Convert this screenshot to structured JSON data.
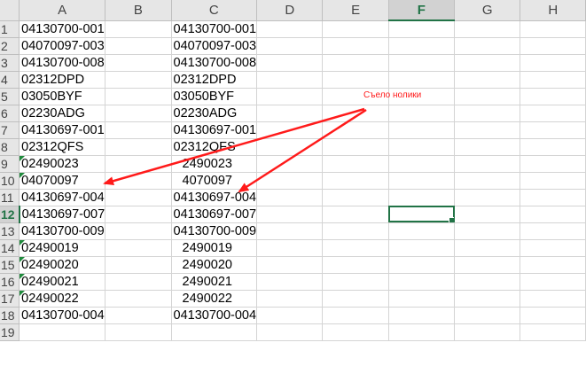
{
  "columns": [
    "A",
    "B",
    "C",
    "D",
    "E",
    "F",
    "G",
    "H"
  ],
  "row_numbers": [
    "1",
    "2",
    "3",
    "4",
    "5",
    "6",
    "7",
    "8",
    "9",
    "10",
    "11",
    "12",
    "13",
    "14",
    "15",
    "16",
    "17",
    "18",
    "19"
  ],
  "active_column": "F",
  "active_row": "12",
  "cells": {
    "a": [
      "04130700-001",
      "04070097-003",
      "04130700-008",
      "02312DPD",
      "03050BYF",
      "02230ADG",
      "04130697-001",
      "02312QFS",
      "02490023",
      "04070097",
      "04130697-004",
      "04130697-007",
      "04130700-009",
      "02490019",
      "02490020",
      "02490021",
      "02490022",
      "04130700-004",
      ""
    ],
    "c": [
      "04130700-001",
      "04070097-003",
      "04130700-008",
      "02312DPD",
      "03050BYF",
      "02230ADG",
      "04130697-001",
      "02312QFS",
      "2490023",
      "4070097",
      "04130697-004",
      "04130697-007",
      "04130700-009",
      "2490019",
      "2490020",
      "2490021",
      "2490022",
      "04130700-004",
      ""
    ]
  },
  "annotation": {
    "text": "Съело нолики",
    "color": "#ff1a1a"
  },
  "colors": {
    "header_bg": "#e6e6e6",
    "grid_line": "#d4d4d4",
    "selection": "#217346",
    "error_triangle": "#1f8a3c"
  }
}
